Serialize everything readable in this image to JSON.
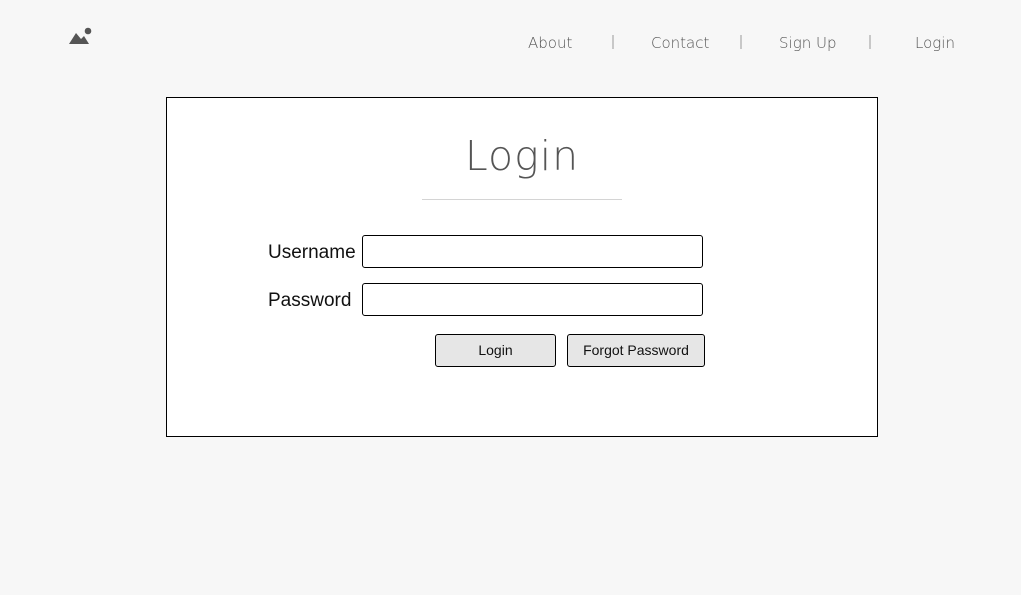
{
  "header": {
    "logo_icon": "image-icon",
    "nav": [
      {
        "label": "About"
      },
      {
        "label": "Contact"
      },
      {
        "label": "Sign Up"
      },
      {
        "label": "Login"
      }
    ]
  },
  "login": {
    "title": "Login",
    "username": {
      "label": "Username",
      "value": "",
      "placeholder": ""
    },
    "password": {
      "label": "Password",
      "value": "",
      "placeholder": ""
    },
    "login_button": "Login",
    "forgot_button": "Forgot Password"
  },
  "colors": {
    "background": "#f7f7f7",
    "card_background": "#ffffff",
    "button_background": "#e6e6e6",
    "nav_text": "#555555"
  }
}
